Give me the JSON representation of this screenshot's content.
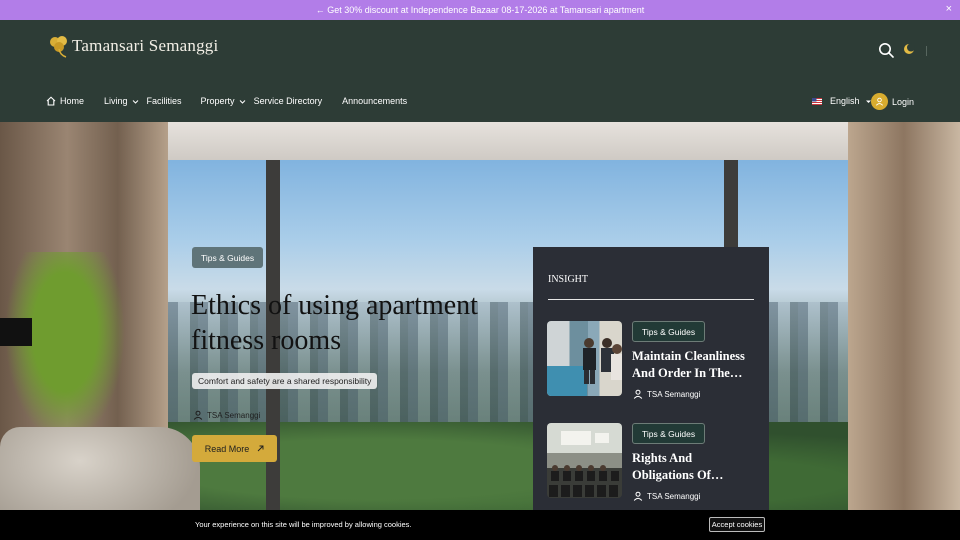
{
  "promo": {
    "text": "← Get 30% discount at Independence Bazaar 08-17-2026 at Tamansari apartment",
    "close": "×"
  },
  "brand": {
    "name": "Tamansari Semanggi",
    "logo_icon": "clover-logo-icon",
    "accent": "#d4aa3b"
  },
  "header": {
    "search_icon": "search-icon",
    "theme_icon": "moon-icon"
  },
  "nav": {
    "home": "Home",
    "living": "Living",
    "facilities": "Facilities",
    "property": "Property",
    "service_directory": "Service Directory",
    "announcements": "Announcements"
  },
  "language": {
    "selected": "English",
    "flag_icon": "us-flag-icon"
  },
  "login": {
    "label": "Login"
  },
  "hero": {
    "tag": "Tips & Guides",
    "title": "Ethics of using apartment fitness rooms",
    "subtitle": "Comfort and safety are a shared responsibility",
    "author": "TSA Semanggi",
    "cta": "Read More"
  },
  "insight": {
    "title": "INSIGHT",
    "cards": [
      {
        "tag": "Tips & Guides",
        "title": "Maintain Cleanliness And Order In The…",
        "author": "TSA Semanggi"
      },
      {
        "tag": "Tips & Guides",
        "title": "Rights And Obligations Of…",
        "author": "TSA Semanggi"
      }
    ]
  },
  "cookie": {
    "message": "Your experience on this site will be improved by allowing cookies.",
    "button": "Accept cookies"
  }
}
